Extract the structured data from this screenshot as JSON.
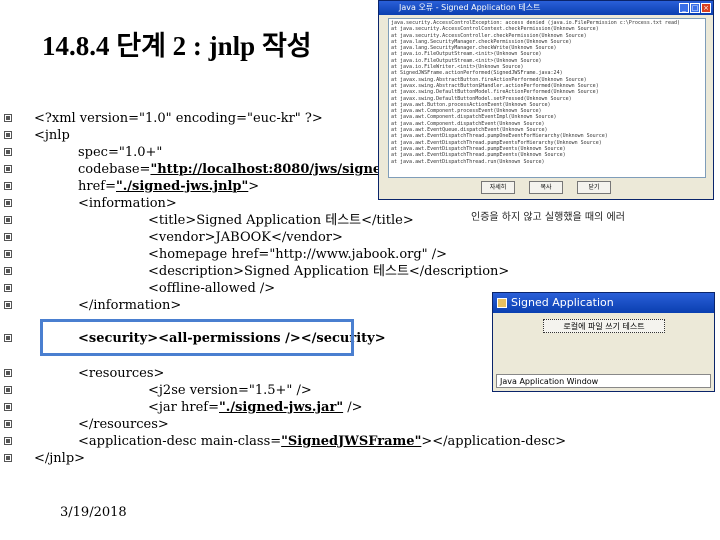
{
  "slide": {
    "title": "14.8.4 단계 2 : jnlp 작성",
    "date": "3/19/2018"
  },
  "code_lines": [
    {
      "indent": 0,
      "parts": [
        {
          "t": "<?xml version=\"1.0\" encoding=\"euc-kr\" ?>",
          "s": ""
        }
      ]
    },
    {
      "indent": 0,
      "parts": [
        {
          "t": "<jnlp",
          "s": ""
        }
      ]
    },
    {
      "indent": 1,
      "parts": [
        {
          "t": "spec=\"1.0+\"",
          "s": ""
        }
      ]
    },
    {
      "indent": 1,
      "parts": [
        {
          "t": "codebase=",
          "s": ""
        },
        {
          "t": "\"http://localhost:8080/jws/signed-jws\"",
          "s": "bold-u"
        }
      ]
    },
    {
      "indent": 1,
      "parts": [
        {
          "t": "href=",
          "s": ""
        },
        {
          "t": "\"./signed-jws.jnlp\"",
          "s": "bold-u"
        },
        {
          "t": ">",
          "s": ""
        }
      ]
    },
    {
      "indent": 1,
      "parts": [
        {
          "t": "<information>",
          "s": ""
        }
      ]
    },
    {
      "indent": 2,
      "parts": [
        {
          "t": "<title>Signed Application 테스트</title>",
          "s": ""
        }
      ]
    },
    {
      "indent": 2,
      "parts": [
        {
          "t": "<vendor>JABOOK</vendor>",
          "s": ""
        }
      ]
    },
    {
      "indent": 2,
      "parts": [
        {
          "t": "<homepage href=\"http://www.jabook.org\" />",
          "s": ""
        }
      ]
    },
    {
      "indent": 2,
      "parts": [
        {
          "t": "<description>Signed Application 테스트</description>",
          "s": ""
        }
      ]
    },
    {
      "indent": 2,
      "parts": [
        {
          "t": "<offline-allowed />",
          "s": ""
        }
      ]
    },
    {
      "indent": 1,
      "parts": [
        {
          "t": "</information>",
          "s": ""
        }
      ]
    },
    {
      "indent": 1,
      "parts": [
        {
          "t": "<security><all-permissions /></security>",
          "s": "bold"
        }
      ]
    },
    {
      "indent": 1,
      "parts": [
        {
          "t": "<resources>",
          "s": ""
        }
      ]
    },
    {
      "indent": 2,
      "parts": [
        {
          "t": "<j2se version=\"1.5+\" />",
          "s": ""
        }
      ]
    },
    {
      "indent": 2,
      "parts": [
        {
          "t": "<jar href=",
          "s": ""
        },
        {
          "t": "\"./signed-jws.jar\"",
          "s": "bold-u"
        },
        {
          "t": " />",
          "s": ""
        }
      ]
    },
    {
      "indent": 1,
      "parts": [
        {
          "t": "</resources>",
          "s": ""
        }
      ]
    },
    {
      "indent": 1,
      "parts": [
        {
          "t": "<application-desc main-class=",
          "s": ""
        },
        {
          "t": "\"SignedJWSFrame\"",
          "s": "bold-u"
        },
        {
          "t": "></application-desc>",
          "s": ""
        }
      ]
    },
    {
      "indent": 0,
      "parts": [
        {
          "t": "</jnlp>",
          "s": ""
        }
      ]
    }
  ],
  "error_window": {
    "title": "Java 오류 - Signed Application 테스트",
    "lines": [
      "java.security.AccessControlException: access denied (java.io.FilePermission c:\\Process.txt read)",
      "    at java.security.AccessControlContext.checkPermission(Unknown Source)",
      "    at java.security.AccessController.checkPermission(Unknown Source)",
      "    at java.lang.SecurityManager.checkPermission(Unknown Source)",
      "    at java.lang.SecurityManager.checkWrite(Unknown Source)",
      "    at java.io.FileOutputStream.<init>(Unknown Source)",
      "    at java.io.FileOutputStream.<init>(Unknown Source)",
      "    at java.io.FileWriter.<init>(Unknown Source)",
      "    at SignedJWSFrame.actionPerformed(SignedJWSFrame.java:24)",
      "    at javax.swing.AbstractButton.fireActionPerformed(Unknown Source)",
      "    at javax.swing.AbstractButton$Handler.actionPerformed(Unknown Source)",
      "    at javax.swing.DefaultButtonModel.fireActionPerformed(Unknown Source)",
      "    at javax.swing.DefaultButtonModel.setPressed(Unknown Source)",
      "    at java.awt.Button.processActionEvent(Unknown Source)",
      "    at java.awt.Component.processEvent(Unknown Source)",
      "    at java.awt.Component.dispatchEventImpl(Unknown Source)",
      "    at java.awt.Component.dispatchEvent(Unknown Source)",
      "    at java.awt.EventQueue.dispatchEvent(Unknown Source)",
      "    at java.awt.EventDispatchThread.pumpOneEventForHierarchy(Unknown Source)",
      "    at java.awt.EventDispatchThread.pumpEventsForHierarchy(Unknown Source)",
      "    at java.awt.EventDispatchThread.pumpEvents(Unknown Source)",
      "    at java.awt.EventDispatchThread.pumpEvents(Unknown Source)",
      "    at java.awt.EventDispatchThread.run(Unknown Source)"
    ],
    "buttons": [
      "자세히",
      "복사",
      "닫기"
    ]
  },
  "error_caption": "인증을 하지 않고 실행했을 때의 에러",
  "app_window": {
    "title": "Signed Application",
    "button_label": "로컬에 파일 쓰기 테스트",
    "status": "Java Application Window"
  }
}
